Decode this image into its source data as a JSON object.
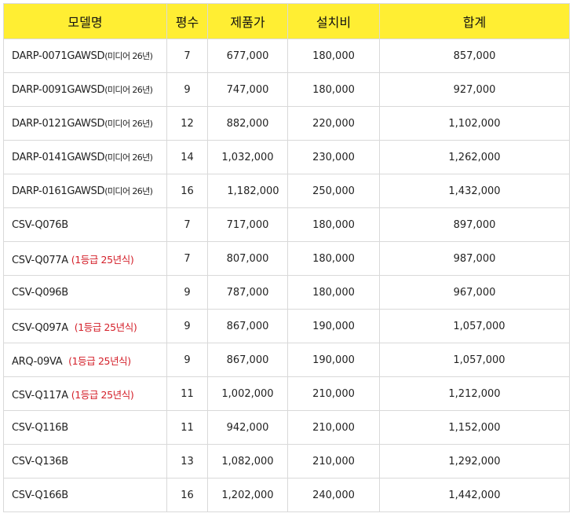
{
  "headers": {
    "model": "모델명",
    "size": "평수",
    "price": "제품가",
    "install": "설치비",
    "total": "합계"
  },
  "rows": [
    {
      "name": "DARP-0071GAWSD",
      "sub": "(미디어 26년)",
      "tag": "",
      "size": "7",
      "price": "677,000",
      "install": "180,000",
      "total": "857,000"
    },
    {
      "name": "DARP-0091GAWSD",
      "sub": "(미디어 26년)",
      "tag": "",
      "size": "9",
      "price": "747,000",
      "install": "180,000",
      "total": "927,000"
    },
    {
      "name": "DARP-0121GAWSD",
      "sub": "(미디어 26년)",
      "tag": "",
      "size": "12",
      "price": "882,000",
      "install": "220,000",
      "total": "1,102,000"
    },
    {
      "name": "DARP-0141GAWSD",
      "sub": "(미디어 26년)",
      "tag": "",
      "size": "14",
      "price": "1,032,000",
      "install": "230,000",
      "total": "1,262,000"
    },
    {
      "name": "DARP-0161GAWSD",
      "sub": "(미디어 26년)",
      "tag": "",
      "size": "16",
      "price": "1,182,000",
      "install": "250,000",
      "total": "1,432,000"
    },
    {
      "name": "CSV-Q076B",
      "sub": "",
      "tag": "",
      "size": "7",
      "price": "717,000",
      "install": "180,000",
      "total": "897,000"
    },
    {
      "name": "CSV-Q077A",
      "sub": "",
      "tag": "(1등급 25년식)",
      "size": "7",
      "price": "807,000",
      "install": "180,000",
      "total": "987,000"
    },
    {
      "name": "CSV-Q096B",
      "sub": "",
      "tag": "",
      "size": "9",
      "price": "787,000",
      "install": "180,000",
      "total": "967,000"
    },
    {
      "name": "CSV-Q097A",
      "sub": "",
      "tag": "(1등급 25년식)",
      "size": "9",
      "price": "867,000",
      "install": "190,000",
      "total": "1,057,000"
    },
    {
      "name": "ARQ-09VA",
      "sub": "",
      "tag": "(1등급 25년식)",
      "size": "9",
      "price": "867,000",
      "install": "190,000",
      "total": "1,057,000"
    },
    {
      "name": "CSV-Q117A",
      "sub": "",
      "tag": "(1등급 25년식)",
      "size": "11",
      "price": "1,002,000",
      "install": "210,000",
      "total": "1,212,000"
    },
    {
      "name": "CSV-Q116B",
      "sub": "",
      "tag": "",
      "size": "11",
      "price": "942,000",
      "install": "210,000",
      "total": "1,152,000"
    },
    {
      "name": "CSV-Q136B",
      "sub": "",
      "tag": "",
      "size": "13",
      "price": "1,082,000",
      "install": "210,000",
      "total": "1,292,000"
    },
    {
      "name": "CSV-Q166B",
      "sub": "",
      "tag": "",
      "size": "16",
      "price": "1,202,000",
      "install": "240,000",
      "total": "1,442,000"
    }
  ],
  "colors": {
    "header_bg": "#ffee33",
    "tag_red": "#d4202a",
    "border": "#d9d9d9"
  }
}
